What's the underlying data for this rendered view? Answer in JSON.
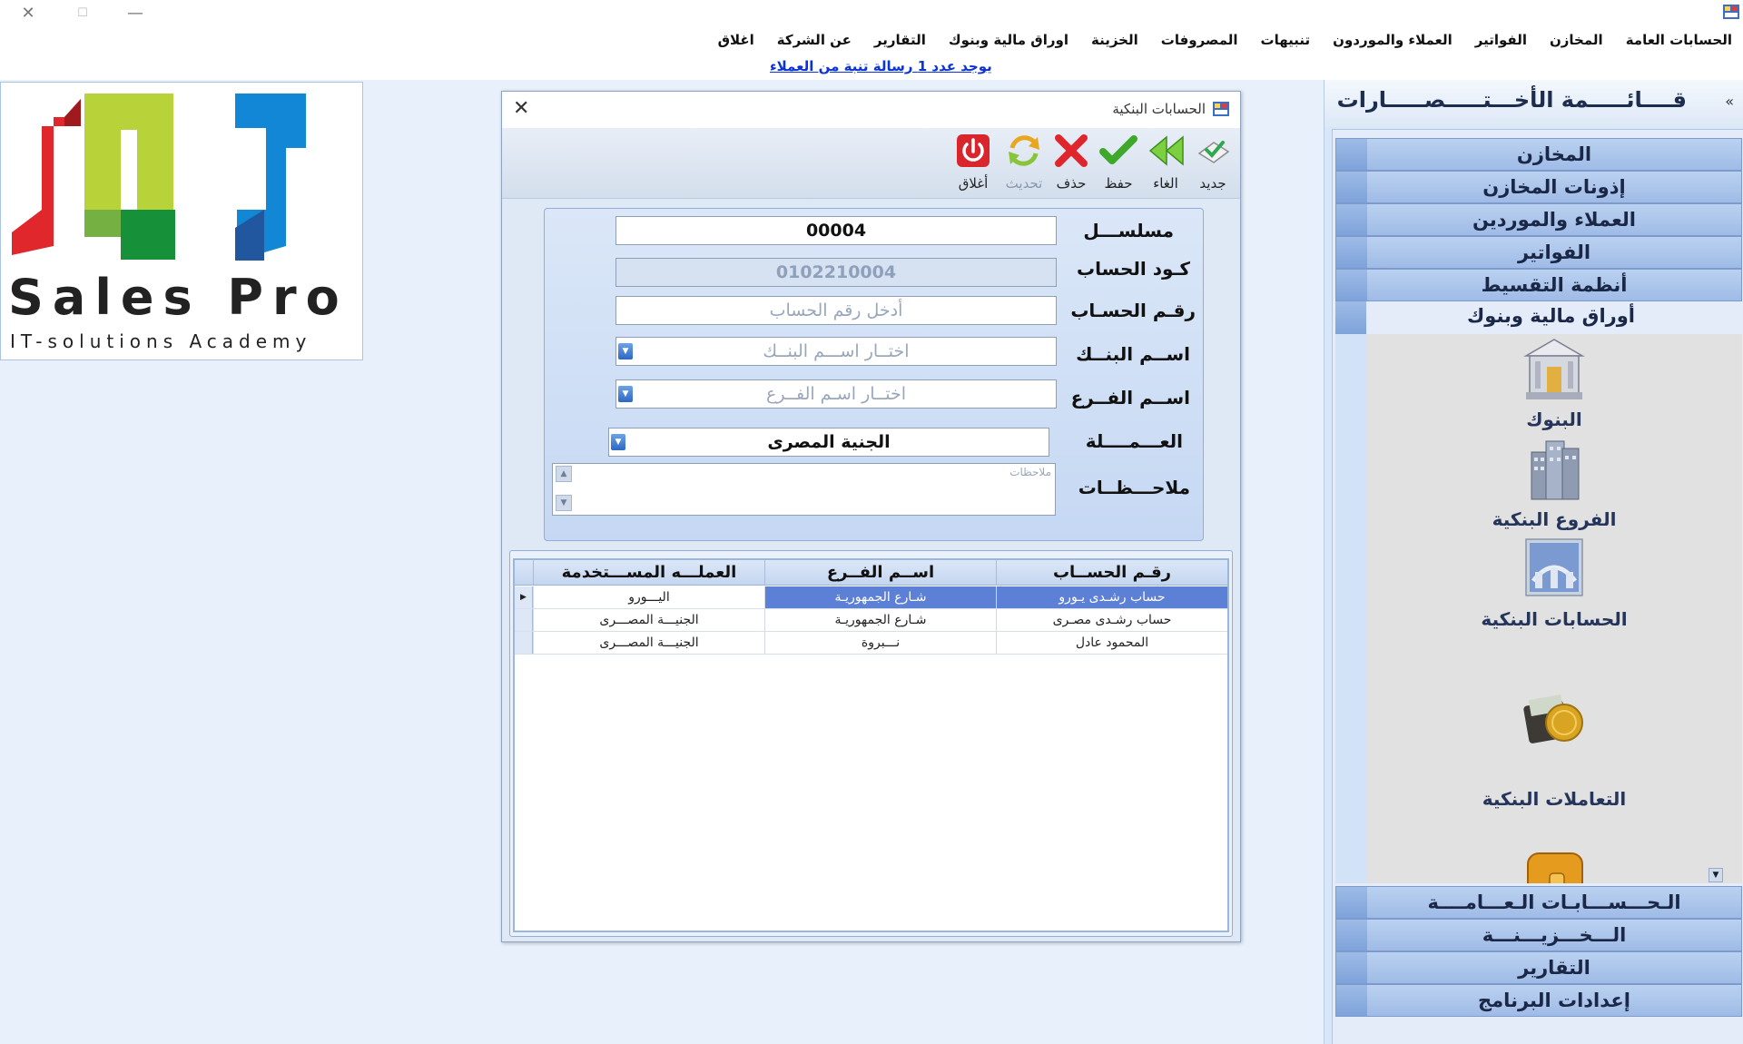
{
  "window": {
    "close_glyph": "✕",
    "maximize_glyph": "☐",
    "minimize_glyph": "—"
  },
  "menu": [
    "الحسابات العامة",
    "المخازن",
    "الفواتير",
    "العملاء والموردون",
    "تنبيهات",
    "المصروفات",
    "الخزينة",
    "اوراق مالية وبنوك",
    "التقارير",
    "عن الشركة",
    "اغلاق"
  ],
  "notice": {
    "text": "يوجد عدد  1 رسالة تنبة من العملاء"
  },
  "logo": {
    "title": "Sales Pro",
    "subtitle": "IT-solutions Academy"
  },
  "dialog": {
    "title": "الحسابات البنكية",
    "close_glyph": "✕",
    "toolbar": {
      "new": "جديد",
      "cancel": "الغاء",
      "save": "حفظ",
      "delete": "حذف",
      "refresh": "تحديث",
      "close": "أغلاق"
    },
    "form": {
      "serial_label": "مسلســـل",
      "serial_value": "00004",
      "account_code_label": "كـود الحساب",
      "account_code_value": "0102210004",
      "account_number_label": "رقـم الحسـاب",
      "account_number_placeholder": "أدخل رقم الحساب",
      "bank_label": "اســم البنــك",
      "bank_placeholder": "اختــار اســـم البنــك",
      "branch_label": "اســم الفــرع",
      "branch_placeholder": "اختــار اسـم الفــرع",
      "currency_label": "العـــمــــلة",
      "currency_value": "الجنية المصرى",
      "notes_label": "ملاحـــظــات",
      "notes_placeholder": "ملاحظات"
    },
    "grid": {
      "columns": [
        "رقـم الحســاب",
        "اســم الفــرع",
        "العملـــه المســـتخدمة"
      ],
      "rows": [
        [
          "حساب رشـدى يـورو",
          "شـارع الجمهوريـة",
          "اليـــورو"
        ],
        [
          "حساب رشـدى مصـرى",
          "شـارع الجمهوريـة",
          "الجنيـــة المصـــرى"
        ],
        [
          "المحمود عادل",
          "نـــبروة",
          "الجنيـــة المصـــرى"
        ]
      ],
      "selected_row": 0,
      "row_indicator_glyph": "▶"
    }
  },
  "sidebar": {
    "title": "قــــائـــــمة الأخـــتـــــصـــــارات",
    "collapse_glyph": "«",
    "groups_top": [
      "المخازن",
      "إذونات المخازن",
      "العملاء والموردين",
      "الفواتير",
      "أنظمة التقسيط"
    ],
    "open_group": "أوراق مالية وبنوك",
    "shortcuts": [
      {
        "label": "البنوك",
        "icon": "bank-building-icon"
      },
      {
        "label": "الفروع البنكية",
        "icon": "branch-towers-icon"
      },
      {
        "label": "الحسابات البنكية",
        "icon": "bank-accounts-icon"
      },
      {
        "label": "التعاملات البنكية",
        "icon": "coin-wallet-icon"
      },
      {
        "label": "",
        "icon": "wallet-icon"
      }
    ],
    "groups_bottom": [
      "الـحـــســـابـات الـعـــامــــة",
      "الـــخـــزيـــنـــة",
      "التقارير",
      "إعدادات البرنامج"
    ],
    "scroll_down_glyph": "▼"
  },
  "colors": {
    "background": "#e8f0fb",
    "link": "#0b33d6",
    "grid_selection": "#5b80d6",
    "sidebar_group": "#9fbbe6"
  }
}
